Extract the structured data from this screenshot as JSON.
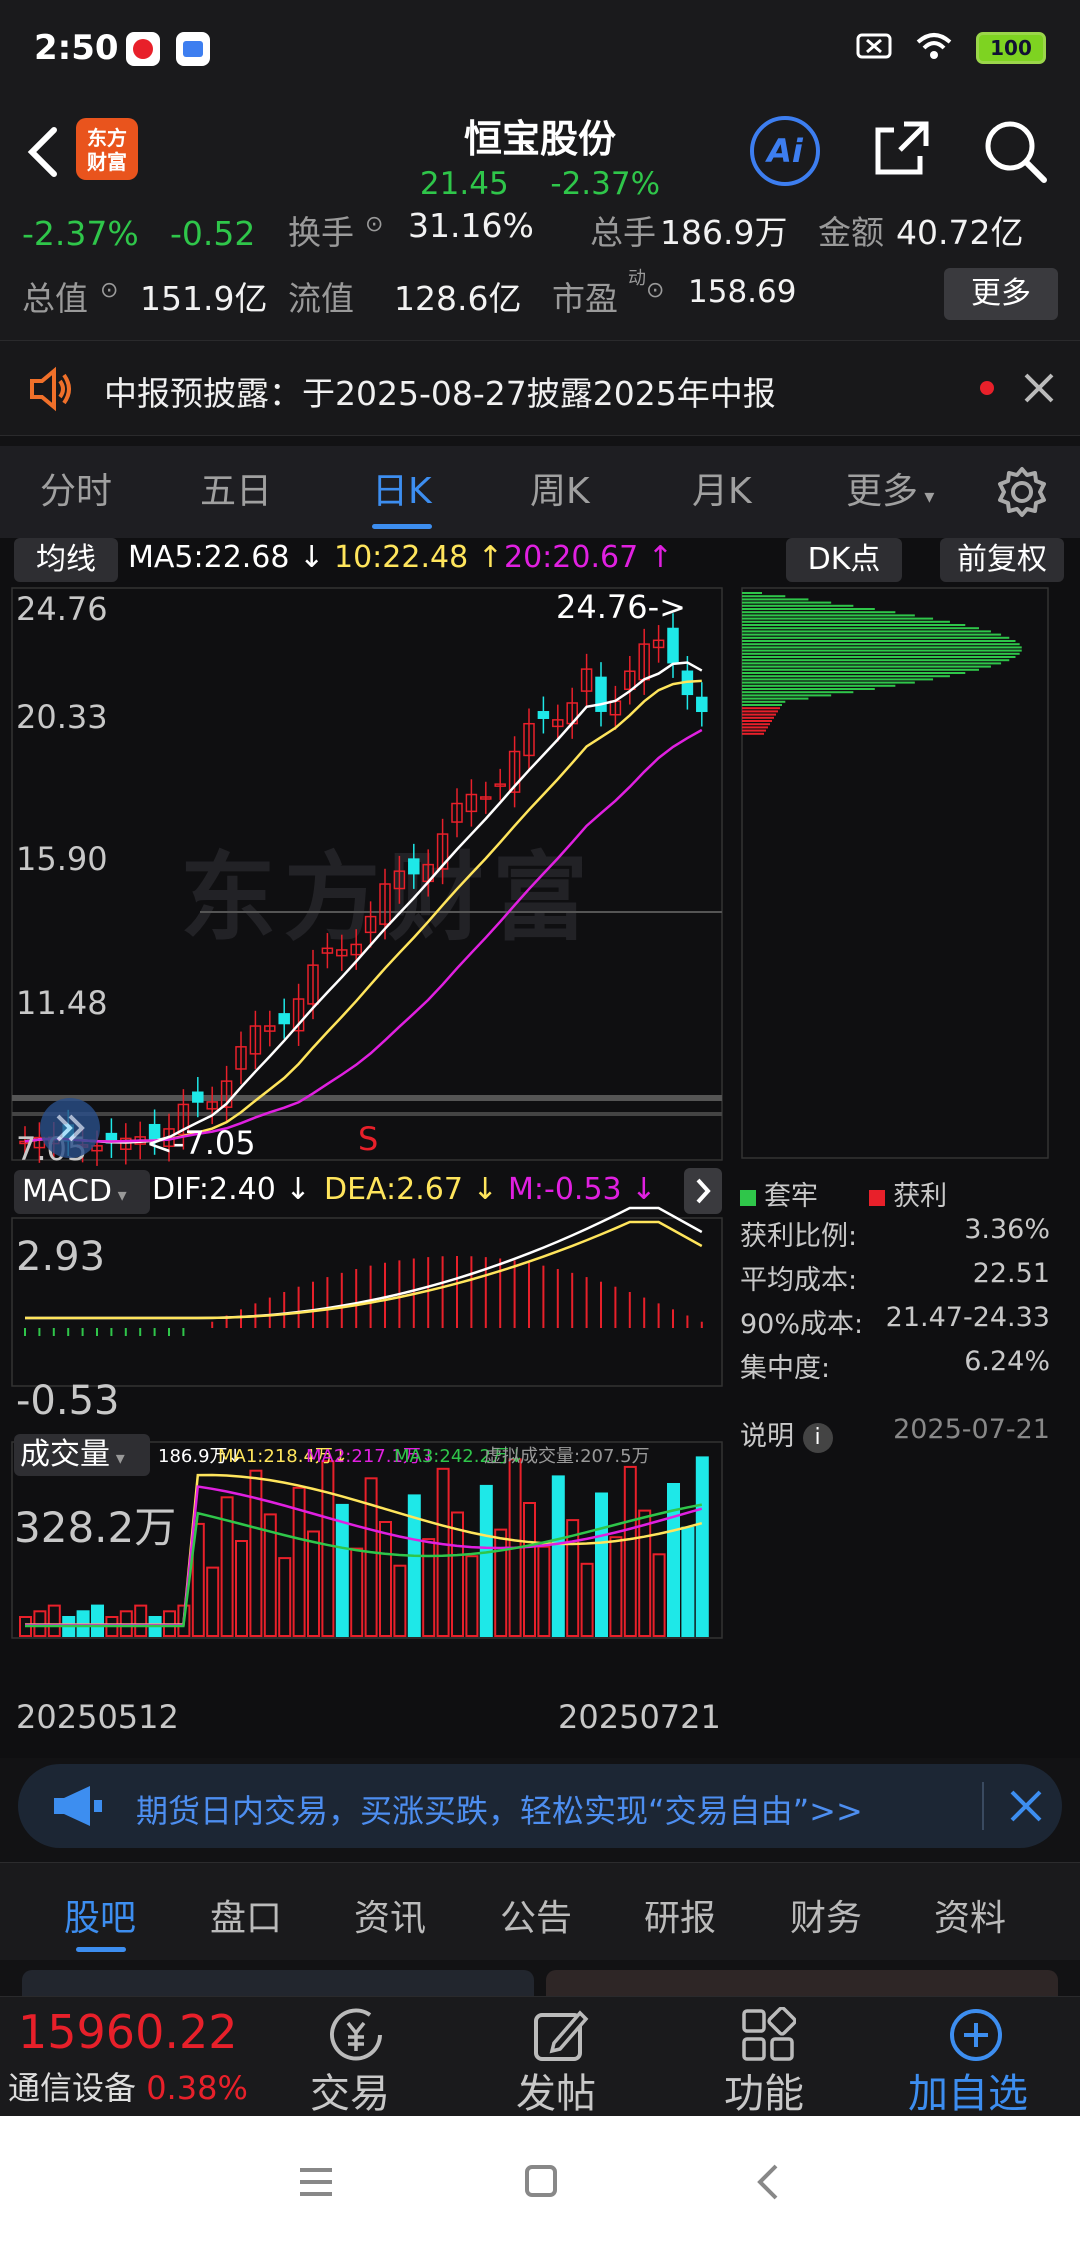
{
  "status": {
    "time": "2:50",
    "battery": "100"
  },
  "header": {
    "brand": "东方\n财富",
    "stock_name": "恒宝股份",
    "price": "21.45",
    "change_pct": "-2.37%",
    "ai": "Ai"
  },
  "quote": {
    "change_pct": "-2.37%",
    "change_amt": "-0.52",
    "turnover_label": "换手",
    "turnover": "31.16%",
    "volume_label": "总手",
    "volume": "186.9万",
    "amount_label": "金额",
    "amount": "40.72亿",
    "mktcap_label": "总值",
    "mktcap": "151.9亿",
    "float_label": "流值",
    "float": "128.6亿",
    "pe_label": "市盈",
    "pe_sup": "动",
    "pe": "158.69",
    "more": "更多"
  },
  "notice": {
    "text": "中报预披露：于2025-08-27披露2025年中报"
  },
  "period_tabs": [
    "分时",
    "五日",
    "日K",
    "周K",
    "月K",
    "更多"
  ],
  "kline": {
    "indicator": "均线",
    "ma5": "MA5:22.68",
    "ma10": "10:22.48",
    "ma20": "20:20.67",
    "dk_btn": "DK点",
    "adj_btn": "前复权",
    "y_ticks": [
      "24.76",
      "20.33",
      "15.90",
      "11.48",
      "7.05"
    ],
    "high_marker": "24.76->",
    "low_marker": "<-7.05",
    "s_mark": "S",
    "watermark": "东方财富"
  },
  "macd": {
    "name": "MACD",
    "dif": "DIF:2.40",
    "dea": "DEA:2.67",
    "m": "M:-0.53",
    "top": "2.93",
    "bottom": "-0.53"
  },
  "volume": {
    "name": "成交量",
    "v": "186.9万",
    "ma1": "MA1:218.4万",
    "ma2": "MA2:217.1万",
    "ma3": "MA3:242.2万",
    "virtual": "虚拟成交量:207.5万",
    "top": "328.2万",
    "start_date": "20250512",
    "end_date": "20250721"
  },
  "chip": {
    "trapped": "套牢",
    "profit": "获利",
    "rows": [
      {
        "label": "获利比例:",
        "value": "3.36%"
      },
      {
        "label": "平均成本:",
        "value": "22.51"
      },
      {
        "label": "90%成本:",
        "value": "21.47-24.33"
      },
      {
        "label": "集中度:",
        "value": "6.24%"
      }
    ],
    "note": "说明",
    "date": "2025-07-21"
  },
  "ad": {
    "text": "期货日内交易，买涨买跌，轻松实现“交易自由”>>"
  },
  "section_tabs": [
    "股吧",
    "盘口",
    "资讯",
    "公告",
    "研报",
    "财务",
    "资料"
  ],
  "bottom": {
    "index_value": "15960.22",
    "index_name": "通信设备",
    "index_pct": "0.38%",
    "trade": "交易",
    "post": "发帖",
    "func": "功能",
    "add": "加自选"
  },
  "colors": {
    "up": "#e8202a",
    "down": "#2fc64a",
    "accent": "#3d8ef0",
    "cyan": "#1ee8e8"
  }
}
